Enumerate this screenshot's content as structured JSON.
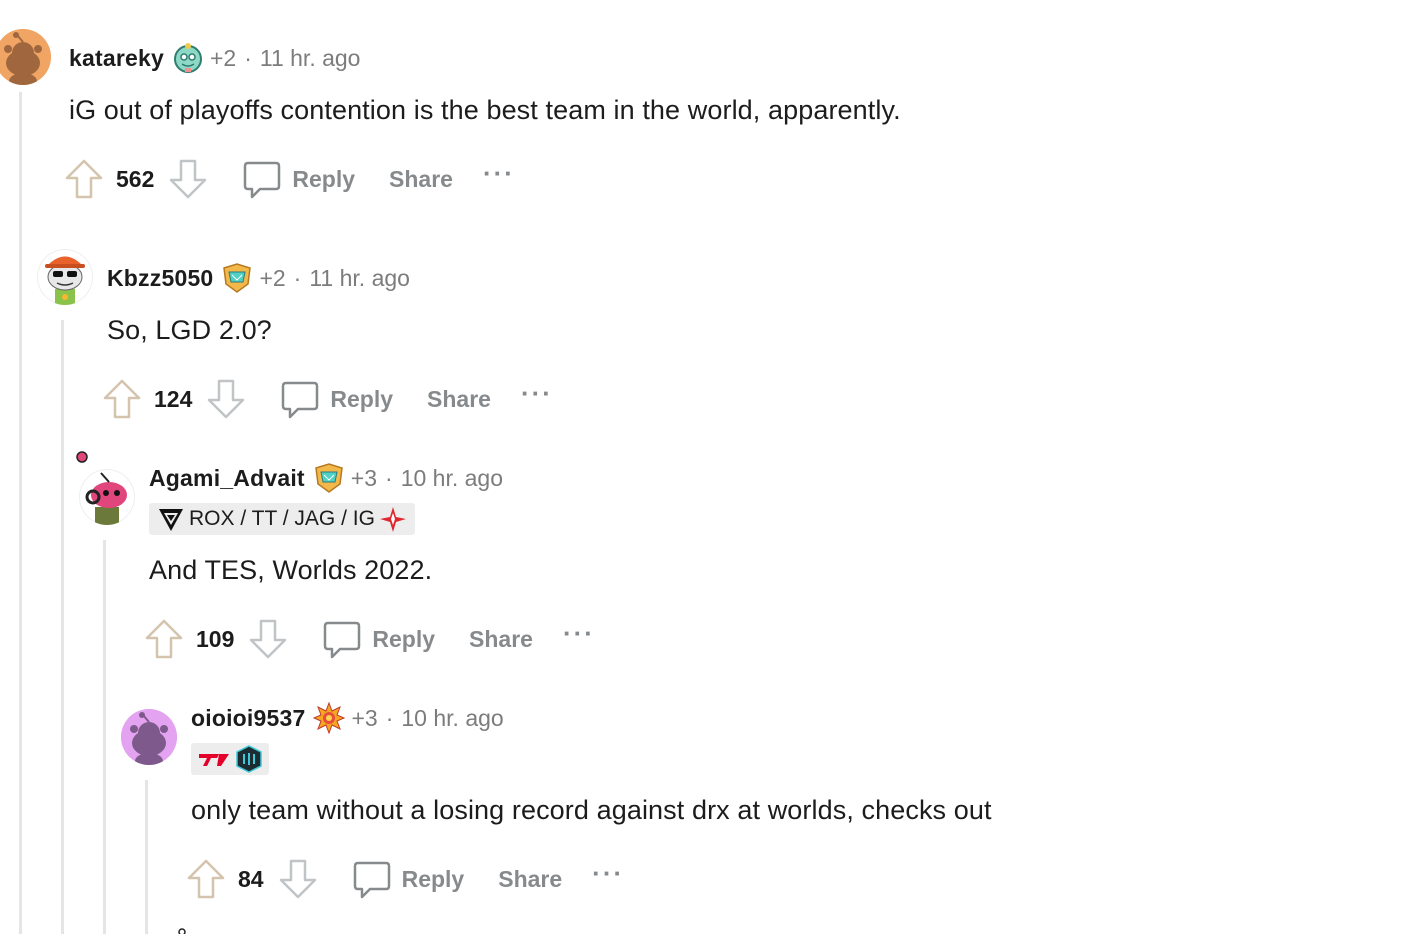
{
  "comments": [
    {
      "username": "katareky",
      "award_icon": "baby-bot-achievement-icon",
      "plus": "+2",
      "time": "11 hr. ago",
      "flair": null,
      "body": "iG out of playoffs contention is the best team in the world, apparently.",
      "score": "562",
      "reply_label": "Reply",
      "share_label": "Share",
      "more_label": "···"
    },
    {
      "username": "Kbzz5050",
      "award_icon": "gem-shield-achievement-icon",
      "plus": "+2",
      "time": "11 hr. ago",
      "flair": null,
      "body": "So, LGD 2.0?",
      "score": "124",
      "reply_label": "Reply",
      "share_label": "Share",
      "more_label": "···"
    },
    {
      "username": "Agami_Advait",
      "award_icon": "gem-shield-achievement-icon",
      "plus": "+3",
      "time": "10 hr. ago",
      "flair": "ROX / TT / JAG / IG",
      "body": "And TES, Worlds 2022.",
      "score": "109",
      "reply_label": "Reply",
      "share_label": "Share",
      "more_label": "···"
    },
    {
      "username": "oioioi9537",
      "award_icon": "fire-burst-achievement-icon",
      "plus": "+3",
      "time": "10 hr. ago",
      "flair": "",
      "body": "only team without a losing record against drx at worlds, checks out",
      "score": "84",
      "reply_label": "Reply",
      "share_label": "Share",
      "more_label": "···"
    }
  ],
  "colors": {
    "upvote_outline": "#d4c4ad",
    "downvote_outline": "#c0c4c6",
    "muted_text": "#7c7c7c",
    "action_text": "#878a8c",
    "thread_line": "#e5e5e5",
    "flair_bg": "#ededed"
  }
}
